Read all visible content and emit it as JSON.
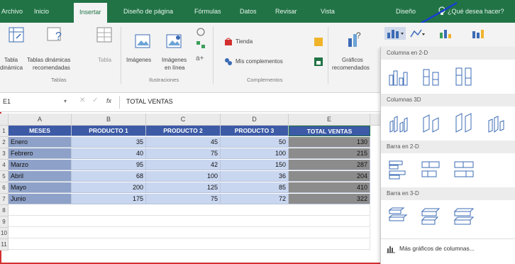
{
  "tabs": [
    {
      "label": "Archivo"
    },
    {
      "label": "Inicio"
    },
    {
      "label": "Insertar"
    },
    {
      "label": "Diseño de página"
    },
    {
      "label": "Fórmulas"
    },
    {
      "label": "Datos"
    },
    {
      "label": "Revisar"
    },
    {
      "label": "Vista"
    },
    {
      "label": "Diseño"
    }
  ],
  "help_label": "¿Qué desea hacer?",
  "ribbon": {
    "tablas_group": {
      "tabla_dinamica_line1": "Tabla",
      "tabla_dinamica_line2": "dinámica",
      "recomendadas_line1": "Tablas dinámicas",
      "recomendadas_line2": "recomendadas",
      "tabla": "Tabla",
      "group_name": "Tablas"
    },
    "ilustraciones_group": {
      "imagenes": "Imágenes",
      "imagenes_linea_line1": "Imágenes",
      "imagenes_linea_line2": "en línea",
      "group_name": "Ilustraciones"
    },
    "complementos_group": {
      "tienda": "Tienda",
      "mis_complementos": "Mis complementos",
      "group_name": "Complementos"
    },
    "graficos": {
      "line1": "Gráficos",
      "line2": "recomendados"
    }
  },
  "formula_bar": {
    "name_box": "E1",
    "fx": "fx",
    "formula": "TOTAL VENTAS"
  },
  "sheet": {
    "columns": [
      "A",
      "B",
      "C",
      "D",
      "E"
    ],
    "row_numbers": [
      "1",
      "2",
      "3",
      "4",
      "5",
      "6",
      "7",
      "8",
      "9",
      "10",
      "11"
    ],
    "headers": [
      "MESES",
      "PRODUCTO 1",
      "PRODUCTO 2",
      "PRODUCTO 3",
      "TOTAL VENTAS"
    ],
    "rows": [
      [
        "Enero",
        "35",
        "45",
        "50",
        "130"
      ],
      [
        "Febrero",
        "40",
        "75",
        "100",
        "215"
      ],
      [
        "Marzo",
        "95",
        "42",
        "150",
        "287"
      ],
      [
        "Abril",
        "68",
        "100",
        "36",
        "204"
      ],
      [
        "Mayo",
        "200",
        "125",
        "85",
        "410"
      ],
      [
        "Junio",
        "175",
        "75",
        "72",
        "322"
      ]
    ]
  },
  "dropdown": {
    "sections": [
      {
        "title": "Columna en 2-D"
      },
      {
        "title": "Columnas 3D"
      },
      {
        "title": "Barra en 2-D"
      },
      {
        "title": "Barra en 3-D"
      }
    ],
    "more_charts": "Más gráficos de columnas..."
  },
  "colors": {
    "excel_green": "#217346",
    "header_blue": "#3c5aa6",
    "month_blue": "#8ea1c8",
    "product_blue": "#c9d6f0",
    "total_gray": "#8c8c8c",
    "annotation_red": "#d32f2f",
    "arrow_blue": "#1a3fd1"
  }
}
